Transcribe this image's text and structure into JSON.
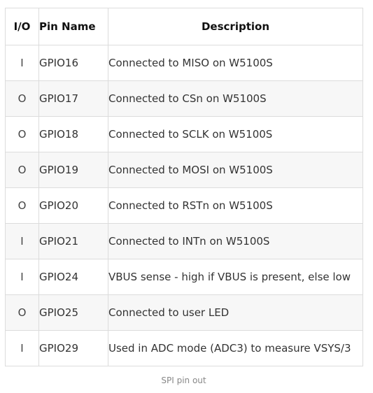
{
  "table": {
    "headers": [
      "I/O",
      "Pin Name",
      "Description"
    ],
    "rows": [
      {
        "io": "I",
        "pin": "GPIO16",
        "desc": "Connected to MISO on W5100S"
      },
      {
        "io": "O",
        "pin": "GPIO17",
        "desc": "Connected to CSn on W5100S"
      },
      {
        "io": "O",
        "pin": "GPIO18",
        "desc": "Connected to SCLK on W5100S"
      },
      {
        "io": "O",
        "pin": "GPIO19",
        "desc": "Connected to MOSI on W5100S"
      },
      {
        "io": "O",
        "pin": "GPIO20",
        "desc": "Connected to RSTn on W5100S"
      },
      {
        "io": "I",
        "pin": "GPIO21",
        "desc": "Connected to INTn on W5100S"
      },
      {
        "io": "I",
        "pin": "GPIO24",
        "desc": "VBUS sense - high if VBUS is present, else low"
      },
      {
        "io": "O",
        "pin": "GPIO25",
        "desc": "Connected to user LED"
      },
      {
        "io": "I",
        "pin": "GPIO29",
        "desc": "Used in ADC mode (ADC3) to measure VSYS/3"
      }
    ]
  },
  "caption": "SPI pin out"
}
